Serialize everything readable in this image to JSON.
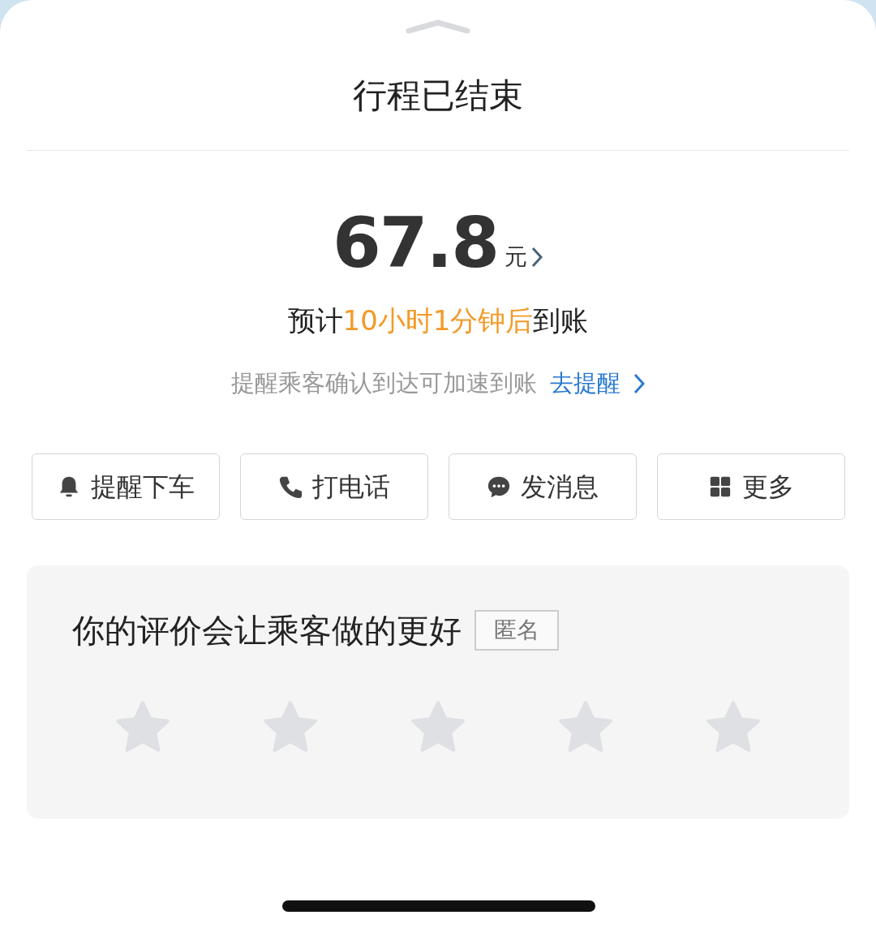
{
  "title": "行程已结束",
  "fare": {
    "amount": "67.8",
    "unit": "元"
  },
  "eta": {
    "prefix": "预计",
    "highlight": "10小时1分钟后",
    "suffix": "到账"
  },
  "reminder": {
    "text": "提醒乘客确认到达可加速到账",
    "link": "去提醒"
  },
  "actions": [
    {
      "kind": "bell",
      "label": "提醒下车"
    },
    {
      "kind": "phone",
      "label": "打电话"
    },
    {
      "kind": "chat",
      "label": "发消息"
    },
    {
      "kind": "grid",
      "label": "更多"
    }
  ],
  "rating": {
    "title": "你的评价会让乘客做的更好",
    "tag": "匿名",
    "stars": 0
  }
}
